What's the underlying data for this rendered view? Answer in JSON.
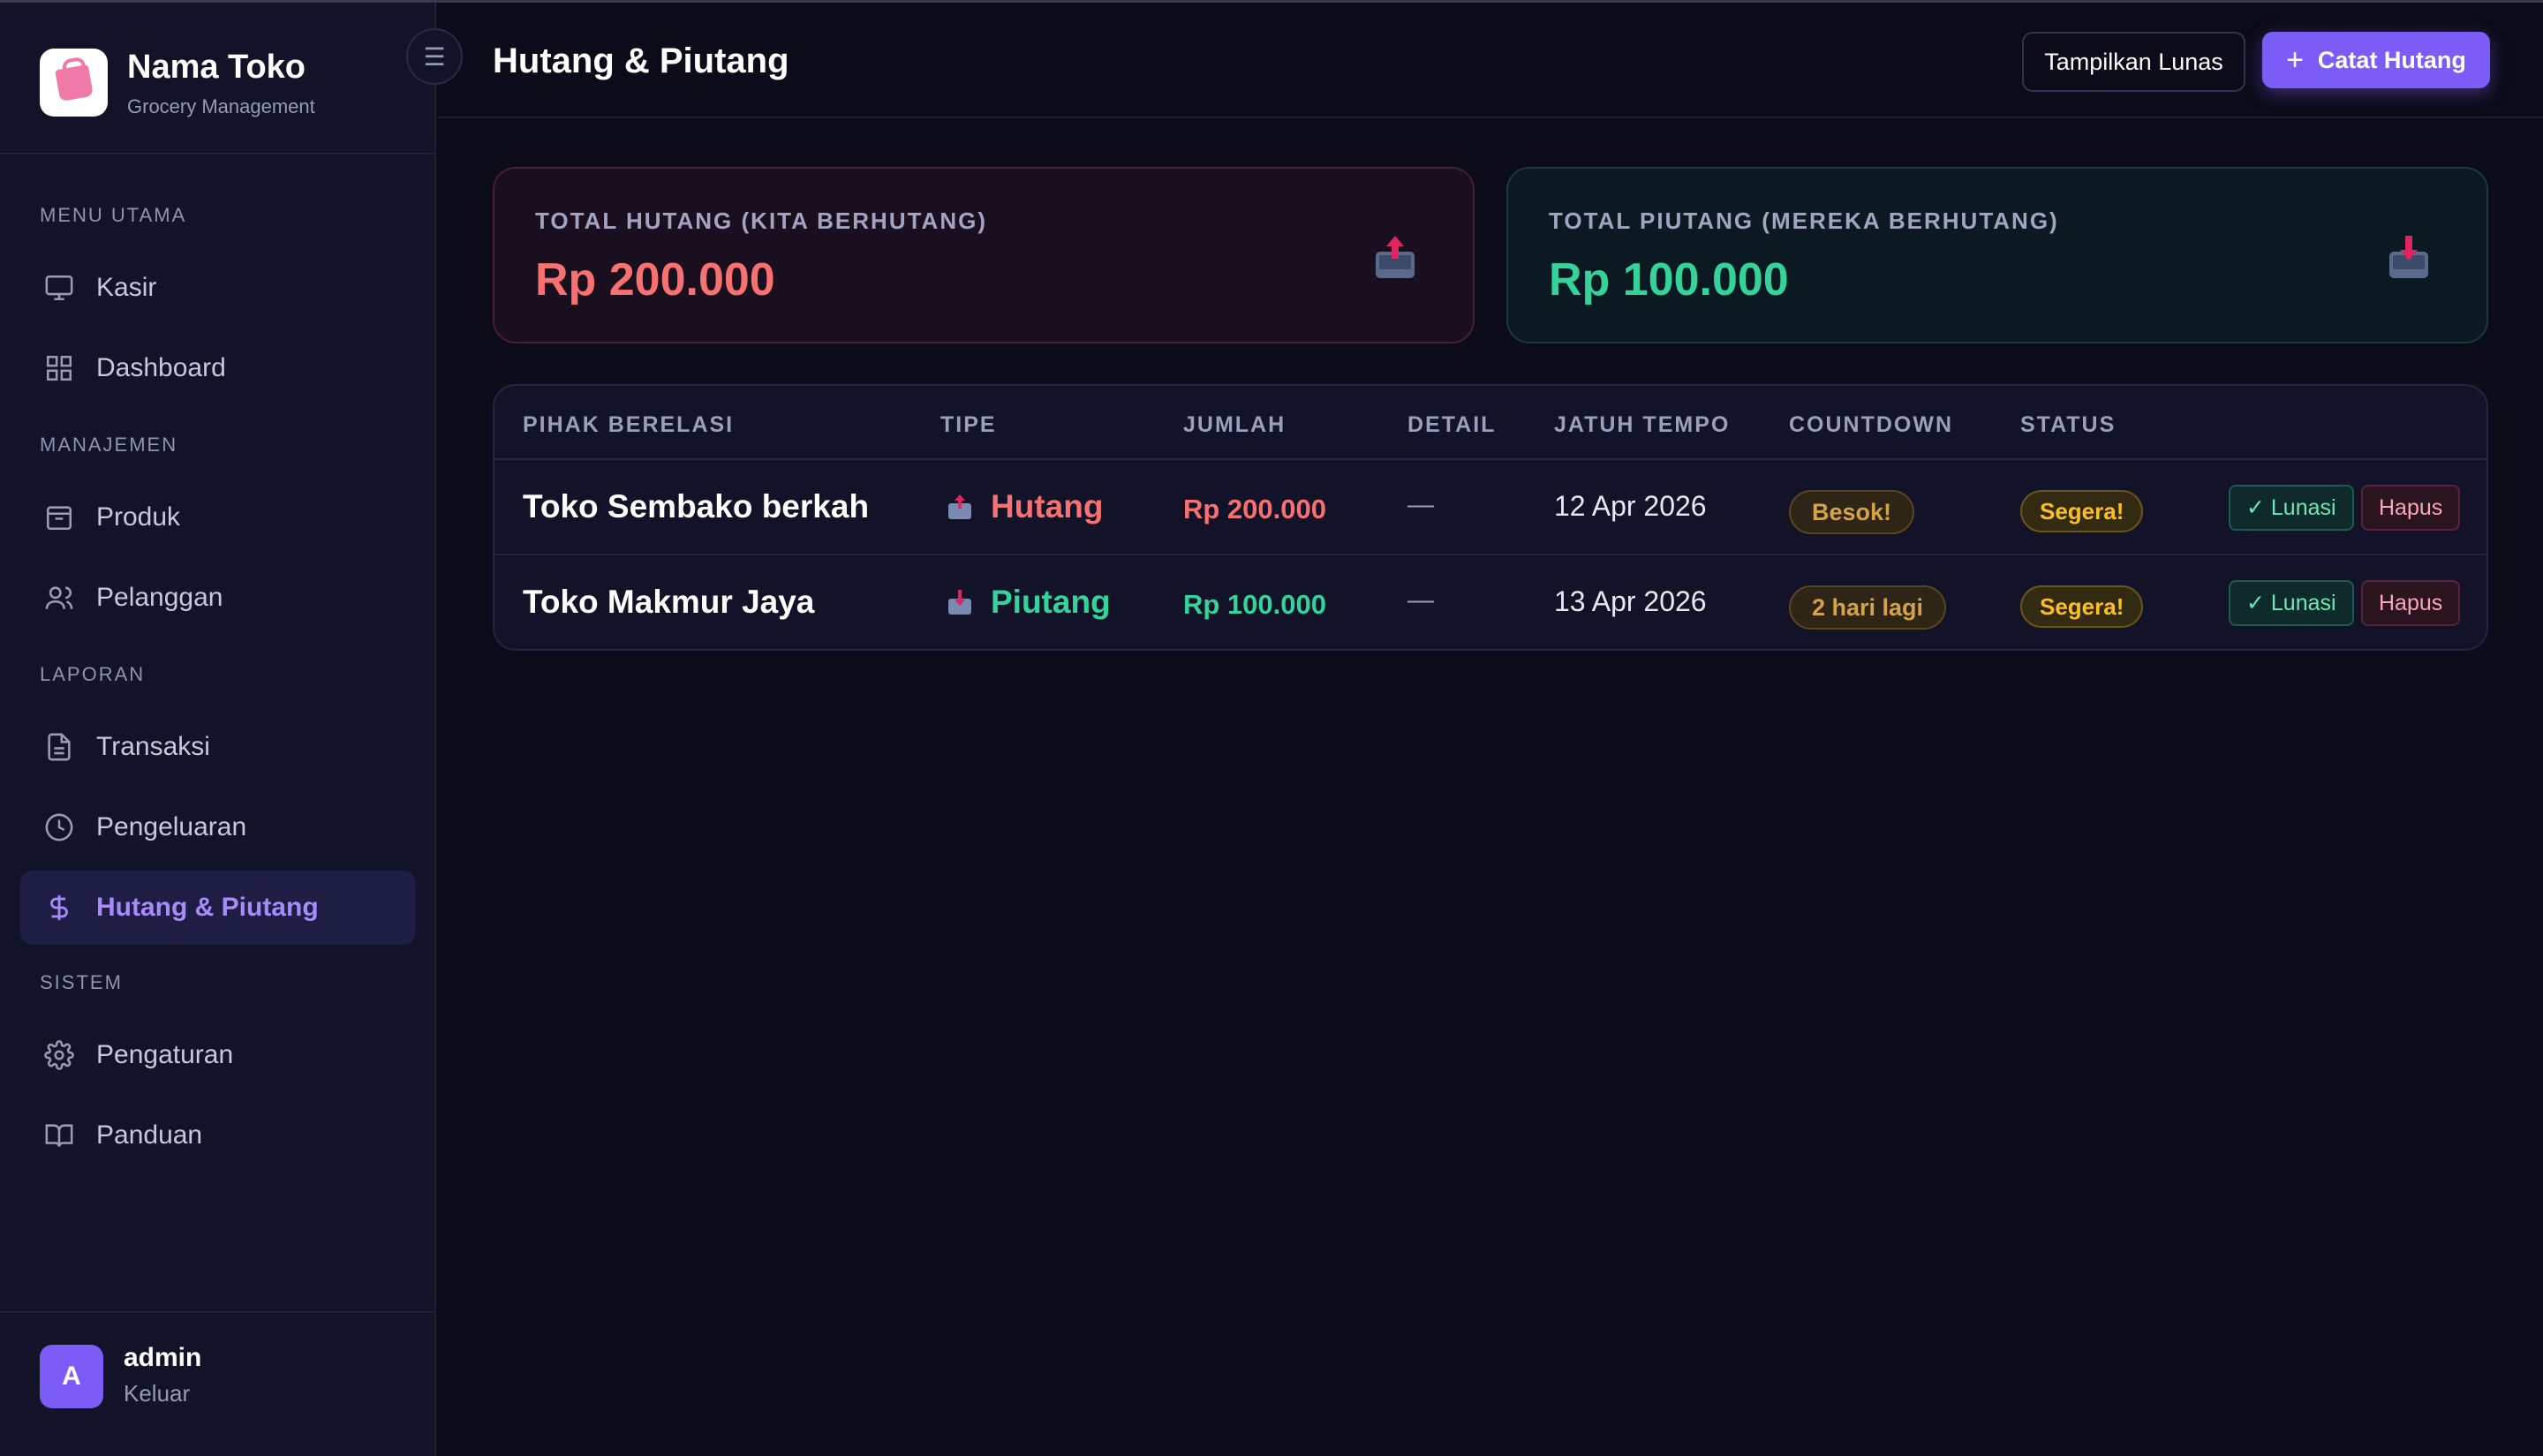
{
  "brand": {
    "name": "Nama Toko",
    "subtitle": "Grocery Management",
    "logo_icon": "shopping-bag-icon"
  },
  "sidebar": {
    "sections": [
      {
        "label": "MENU UTAMA",
        "items": [
          {
            "label": "Kasir",
            "icon": "monitor-icon"
          },
          {
            "label": "Dashboard",
            "icon": "grid-icon"
          }
        ]
      },
      {
        "label": "MANAJEMEN",
        "items": [
          {
            "label": "Produk",
            "icon": "box-icon"
          },
          {
            "label": "Pelanggan",
            "icon": "users-icon"
          }
        ]
      },
      {
        "label": "LAPORAN",
        "items": [
          {
            "label": "Transaksi",
            "icon": "file-text-icon"
          },
          {
            "label": "Pengeluaran",
            "icon": "clock-icon"
          },
          {
            "label": "Hutang & Piutang",
            "icon": "dollar-icon",
            "active": true
          }
        ]
      },
      {
        "label": "SISTEM",
        "items": [
          {
            "label": "Pengaturan",
            "icon": "gear-icon"
          },
          {
            "label": "Panduan",
            "icon": "book-icon"
          }
        ]
      }
    ],
    "toggle_icon": "menu-icon"
  },
  "user": {
    "initial": "A",
    "name": "admin",
    "logout_label": "Keluar"
  },
  "header": {
    "title": "Hutang & Piutang",
    "show_paid_label": "Tampilkan Lunas",
    "add_debt_label": "Catat Hutang"
  },
  "summary": {
    "hutang": {
      "label": "TOTAL HUTANG (KITA BERHUTANG)",
      "value": "Rp 200.000",
      "icon": "outbox-tray-icon"
    },
    "piutang": {
      "label": "TOTAL PIUTANG (MEREKA BERHUTANG)",
      "value": "Rp 100.000",
      "icon": "inbox-tray-icon"
    }
  },
  "table": {
    "columns": [
      "PIHAK BERELASI",
      "TIPE",
      "JUMLAH",
      "DETAIL",
      "JATUH TEMPO",
      "COUNTDOWN",
      "STATUS"
    ],
    "rows": [
      {
        "party": "Toko Sembako berkah",
        "type": "Hutang",
        "amount": "Rp 200.000",
        "detail": "—",
        "due": "12 Apr 2026",
        "countdown": "Besok!",
        "status": "Segera!",
        "pay_label": "✓ Lunasi",
        "delete_label": "Hapus"
      },
      {
        "party": "Toko Makmur Jaya",
        "type": "Piutang",
        "amount": "Rp 100.000",
        "detail": "—",
        "due": "13 Apr 2026",
        "countdown": "2 hari lagi",
        "status": "Segera!",
        "pay_label": "✓ Lunasi",
        "delete_label": "Hapus"
      }
    ]
  },
  "colors": {
    "accent": "#7c5cf6",
    "debt": "#f87171",
    "credit": "#34d399",
    "warning": "#fbbf24"
  }
}
